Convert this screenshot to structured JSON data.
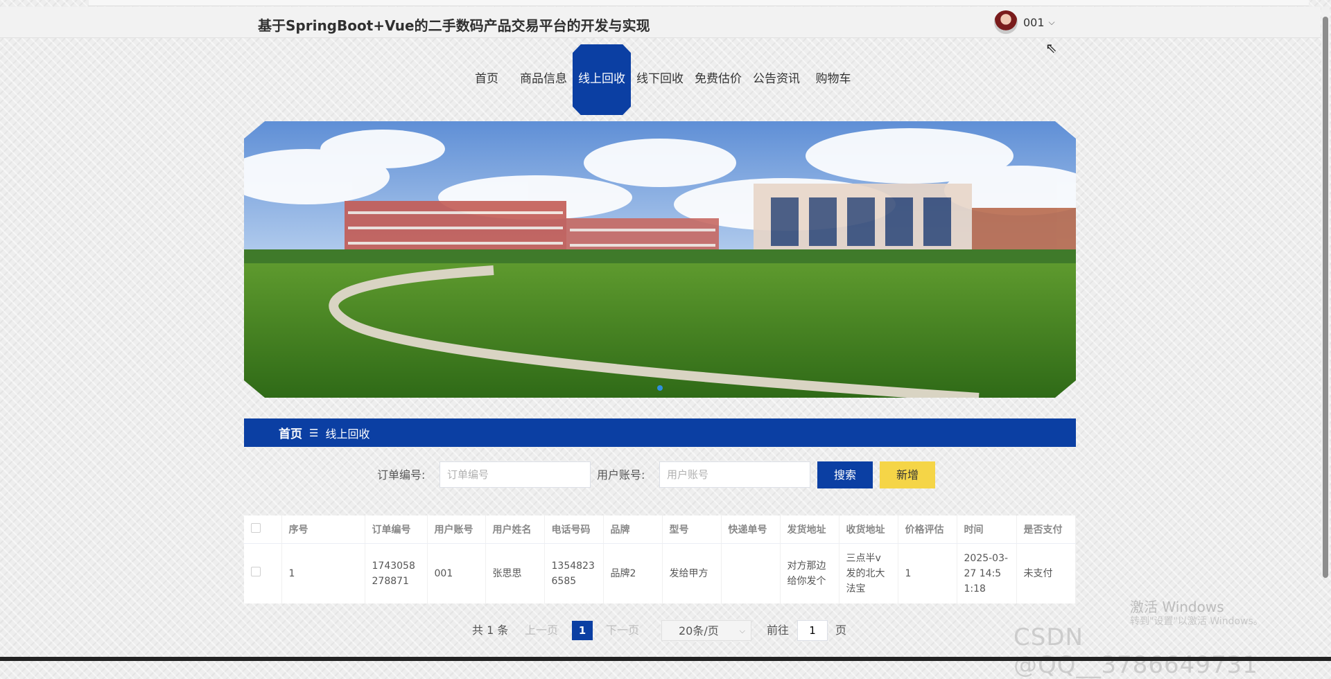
{
  "header": {
    "title": "基于SpringBoot+Vue的二手数码产品交易平台的开发与实现",
    "username": "001"
  },
  "nav": [
    {
      "label": "首页"
    },
    {
      "label": "商品信息"
    },
    {
      "label": "线上回收"
    },
    {
      "label": "线下回收"
    },
    {
      "label": "免费估价"
    },
    {
      "label": "公告资讯"
    },
    {
      "label": "购物车"
    }
  ],
  "breadcrumb": {
    "home": "首页",
    "separator": "☰",
    "current": "线上回收"
  },
  "search": {
    "order_label": "订单编号:",
    "order_placeholder": "订单编号",
    "account_label": "用户账号:",
    "account_placeholder": "用户账号",
    "search_btn": "搜索",
    "add_btn": "新增"
  },
  "table": {
    "headers": [
      "序号",
      "订单编号",
      "用户账号",
      "用户姓名",
      "电话号码",
      "品牌",
      "型号",
      "快递单号",
      "发货地址",
      "收货地址",
      "价格评估",
      "时间",
      "是否支付"
    ],
    "rows": [
      [
        "1",
        "1743058278871",
        "001",
        "张思思",
        "13548236585",
        "品牌2",
        "发给甲方",
        "",
        "对方那边给你发个",
        "三点半v发的北大法宝",
        "1",
        "2025-03-27 14:51:18",
        "未支付"
      ]
    ]
  },
  "pagination": {
    "total": "共 1 条",
    "prev": "上一页",
    "current": "1",
    "next": "下一页",
    "size": "20条/页",
    "goto": "前往",
    "page_value": "1",
    "page_unit": "页"
  },
  "watermark": {
    "activate": "激活 Windows",
    "activate_sub": "转到\"设置\"以激活 Windows。",
    "csdn": "CSDN @QQ__3786649731"
  },
  "colors": {
    "primary": "#0b3fa3",
    "accent": "#f5d547"
  }
}
